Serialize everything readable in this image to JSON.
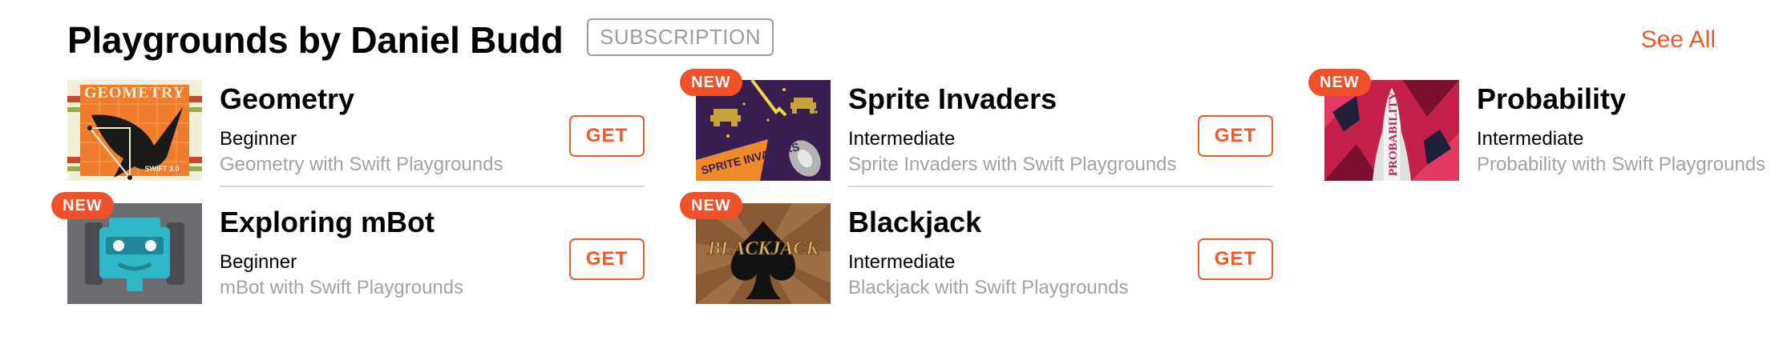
{
  "header": {
    "title": "Playgrounds by Daniel Budd",
    "badge": "SUBSCRIPTION",
    "see_all": "See All"
  },
  "colors": {
    "accent": "#f05a28",
    "new_badge": "#f0512a",
    "muted_text": "#a3a3a3",
    "divider": "#d7d7d7"
  },
  "items": [
    {
      "name": "Geometry",
      "level": "Beginner",
      "description": "Geometry with Swift Playgrounds",
      "button": "GET",
      "badge": "",
      "art_text": "GEOMETRY",
      "art_sub": "SWIFT 3.0"
    },
    {
      "name": "Sprite Invaders",
      "level": "Intermediate",
      "description": "Sprite Invaders with Swift Playgrounds",
      "button": "GET",
      "badge": "NEW",
      "art_text": "SPRITE INVADERS"
    },
    {
      "name": "Probability",
      "level": "Intermediate",
      "description": "Probability with Swift Playgrounds",
      "button": "GET",
      "badge": "NEW",
      "art_text": "PROBABILITY"
    },
    {
      "name": "Exploring mBot",
      "level": "Beginner",
      "description": "mBot with Swift Playgrounds",
      "button": "GET",
      "badge": "NEW"
    },
    {
      "name": "Blackjack",
      "level": "Intermediate",
      "description": "Blackjack with Swift Playgrounds",
      "button": "GET",
      "badge": "NEW",
      "art_text": "BLACKJACK"
    }
  ]
}
